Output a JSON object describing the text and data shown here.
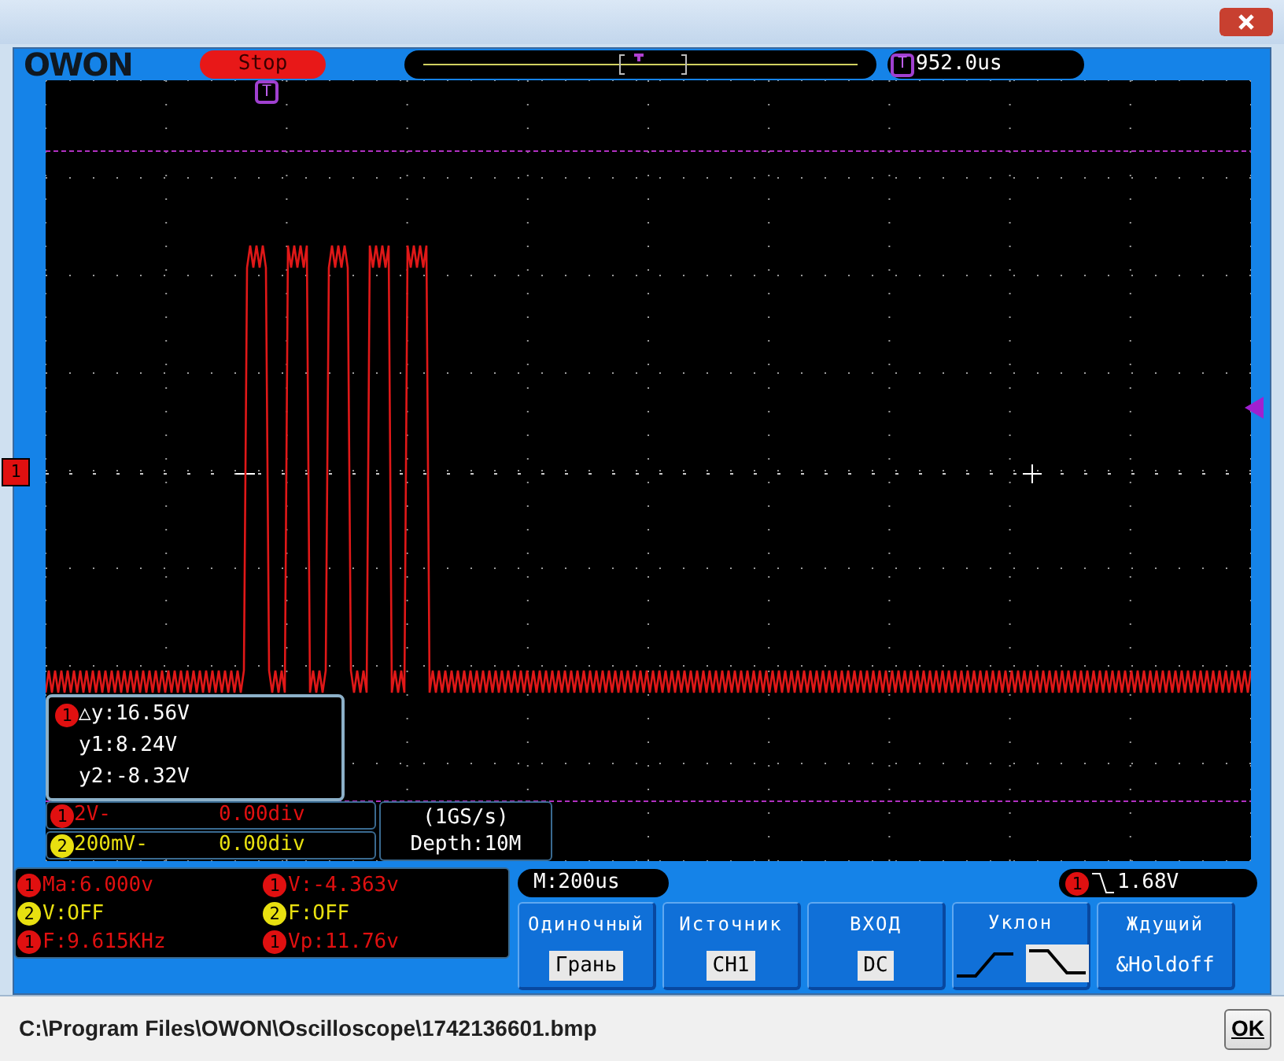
{
  "header": {
    "logo": "OWON",
    "run_state": "Stop",
    "trigger_marker": "T",
    "trigger_time": "952.0us"
  },
  "plot": {
    "channel_marker": "1",
    "trigger_position_marker": "T"
  },
  "cursor_box": {
    "channel": "1",
    "color": "#e01010",
    "lines": [
      "△y:16.56V",
      "y1:8.24V",
      "y2:-8.32V"
    ]
  },
  "channels": [
    {
      "number": "1",
      "color": "#e01010",
      "scale": "2V-",
      "offset": "0.00div"
    },
    {
      "number": "2",
      "color": "#e8e010",
      "scale": "200mV-",
      "offset": "0.00div"
    }
  ],
  "sampling": {
    "rate": "(1GS/s)",
    "depth": "Depth:10M"
  },
  "measurements": [
    {
      "channel": "1",
      "color": "#e01010",
      "text": "Ma:6.000v"
    },
    {
      "channel": "1",
      "color": "#e01010",
      "text": "V:-4.363v"
    },
    {
      "channel": "2",
      "color": "#e8e010",
      "text": "V:OFF"
    },
    {
      "channel": "2",
      "color": "#e8e010",
      "text": "F:OFF"
    },
    {
      "channel": "1",
      "color": "#e01010",
      "text": "F:9.615KHz"
    },
    {
      "channel": "1",
      "color": "#e01010",
      "text": "Vp:11.76v"
    }
  ],
  "timebase": "M:200us",
  "trigger": {
    "channel": "1",
    "color": "#e01010",
    "level": "1.68V"
  },
  "menu": [
    {
      "kind": "boxed",
      "label": "Одиночный",
      "value": "Грань"
    },
    {
      "kind": "boxed",
      "label": "Источник",
      "value": "CH1"
    },
    {
      "kind": "boxed",
      "label": "ВХОД",
      "value": "DC"
    },
    {
      "kind": "slope",
      "label": "Уклон",
      "options": [
        {
          "selected": false
        },
        {
          "selected": true
        }
      ]
    },
    {
      "kind": "plain",
      "label": "Ждущий",
      "value": "&Holdoff"
    }
  ],
  "status_bar": {
    "path": "C:\\Program Files\\OWON\\Oscilloscope\\1742136601.bmp",
    "ok_button": "OK"
  }
}
